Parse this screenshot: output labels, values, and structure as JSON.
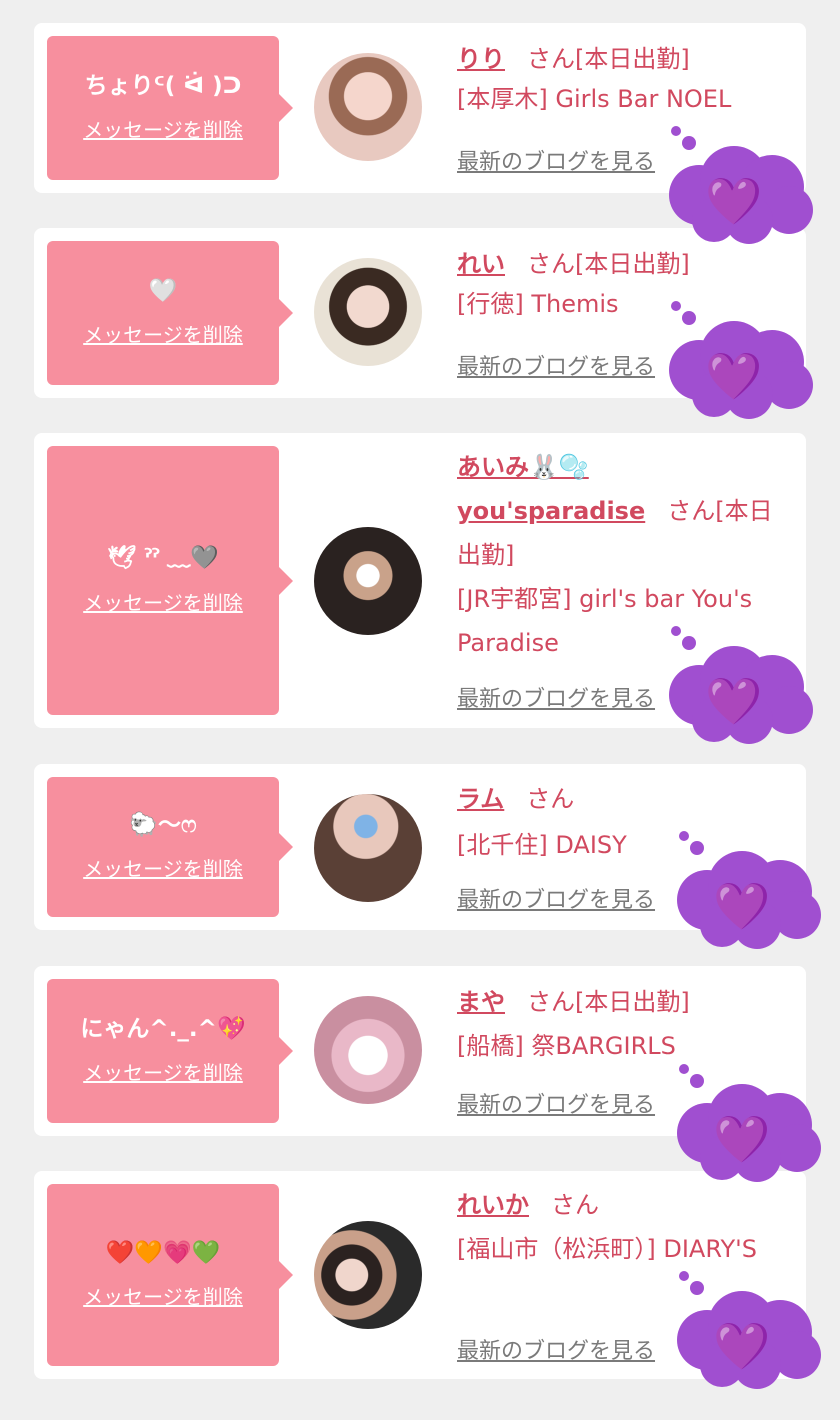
{
  "common": {
    "delete_label": "メッセージを削除",
    "blog_label": "最新のブログを見る",
    "honorific": "さん",
    "heart_emoji": "💜"
  },
  "colors": {
    "bubble": "#f78f9e",
    "name": "#d1495f",
    "thought_cloud": "#a04fd0"
  },
  "messages": [
    {
      "message": "ちょりᑦ( ᐛ )ᑐ",
      "name": "りり",
      "suffix": "[本日出勤]",
      "shop": "[本厚木] Girls Bar NOEL"
    },
    {
      "message": "🤍",
      "name": "れい",
      "suffix": "[本日出勤]",
      "shop": "[行徳] Themis"
    },
    {
      "message": "🕊 ˀˀ ﹏🩶",
      "name": "あいみ🐰🫧 you'sparadise",
      "suffix": "[本日出勤]",
      "shop": "[JR宇都宮] girl's bar You's Paradise"
    },
    {
      "message": "🐑〜ෆ",
      "name": "ラム",
      "suffix": "",
      "shop": "[北千住] DAISY"
    },
    {
      "message": "にゃん^._.^💖",
      "name": "まや",
      "suffix": "[本日出勤]",
      "shop": "[船橋] 祭BARGIRLS"
    },
    {
      "message": "❤️🧡💗💚",
      "name": "れいか",
      "suffix": "",
      "shop": "[福山市（松浜町）] DIARY'S"
    }
  ]
}
